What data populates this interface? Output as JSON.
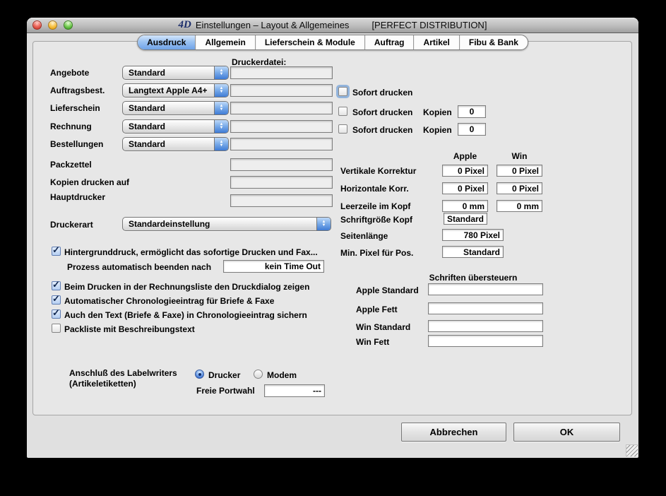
{
  "window": {
    "logo": "4D",
    "title_app": "Einstellungen – Layout & Allgemeines",
    "title_doc": "[PERFECT DISTRIBUTION]"
  },
  "tabs": [
    {
      "label": "Ausdruck",
      "selected": true
    },
    {
      "label": "Allgemein",
      "selected": false
    },
    {
      "label": "Lieferschein & Module",
      "selected": false
    },
    {
      "label": "Auftrag",
      "selected": false
    },
    {
      "label": "Artikel",
      "selected": false
    },
    {
      "label": "Fibu & Bank",
      "selected": false
    }
  ],
  "druckerdatei_header": "Druckerdatei:",
  "print_rows": [
    {
      "label": "Angebote",
      "popup": "Standard",
      "file": ""
    },
    {
      "label": "Auftragsbest.",
      "popup": "Langtext Apple A4+",
      "file": ""
    },
    {
      "label": "Lieferschein",
      "popup": "Standard",
      "file": ""
    },
    {
      "label": "Rechnung",
      "popup": "Standard",
      "file": ""
    },
    {
      "label": "Bestellungen",
      "popup": "Standard",
      "file": ""
    }
  ],
  "plain_rows": [
    {
      "label": "Packzettel",
      "value": ""
    },
    {
      "label": "Kopien drucken auf",
      "value": ""
    },
    {
      "label": "Hauptdrucker",
      "value": ""
    }
  ],
  "druckerart": {
    "label": "Druckerart",
    "value": "Standardeinstellung"
  },
  "checkboxes": {
    "hintergrunddruck": {
      "label": "Hintergrunddruck, ermöglicht das sofortige Drucken und Fax...",
      "checked": true
    },
    "prozess": {
      "label": "Prozess automatisch beenden nach",
      "value": "kein Time Out"
    },
    "druckdialog": {
      "label": "Beim Drucken in der Rechnungsliste den Druckdialog zeigen",
      "checked": true
    },
    "chrono": {
      "label": "Automatischer Chronologieeintrag für Briefe & Faxe",
      "checked": true
    },
    "chronotext": {
      "label": "Auch den Text (Briefe & Faxe) in Chronologieeintrag sichern",
      "checked": true
    },
    "packliste": {
      "label": "Packliste mit Beschreibungstext",
      "checked": false
    }
  },
  "labelwriter": {
    "label_line1": "Anschluß des Labelwriters",
    "label_line2": "(Artikeletiketten)",
    "radio_drucker": "Drucker",
    "radio_modem": "Modem",
    "selected_radio": "Drucker",
    "port_label": "Freie Portwahl",
    "port_value": "---"
  },
  "sofort": [
    {
      "label": "Sofort drucken",
      "checked": false
    },
    {
      "label": "Sofort drucken",
      "checked": false,
      "kopien_label": "Kopien",
      "kopien": "0"
    },
    {
      "label": "Sofort drucken",
      "checked": false,
      "kopien_label": "Kopien",
      "kopien": "0"
    }
  ],
  "correction": {
    "col_apple": "Apple",
    "col_win": "Win",
    "rows": [
      {
        "label": "Vertikale Korrektur",
        "apple": "0 Pixel",
        "win": "0 Pixel"
      },
      {
        "label": "Horizontale Korr.",
        "apple": "0 Pixel",
        "win": "0 Pixel"
      },
      {
        "label": "Leerzeile im Kopf",
        "apple": "0 mm",
        "win": "0 mm"
      },
      {
        "label": "Schriftgröße Kopf",
        "apple": "Standard"
      },
      {
        "label": "Seitenlänge",
        "apple": "780 Pixel"
      },
      {
        "label": "Min. Pixel für Pos.",
        "apple": "Standard"
      }
    ]
  },
  "fonts_override": {
    "header": "Schriften übersteuern",
    "rows": [
      {
        "label": "Apple Standard",
        "value": ""
      },
      {
        "label": "Apple Fett",
        "value": ""
      },
      {
        "label": "Win Standard",
        "value": ""
      },
      {
        "label": "Win Fett",
        "value": ""
      }
    ]
  },
  "buttons": {
    "cancel": "Abbrechen",
    "ok": "OK"
  },
  "icons": {
    "checkmark": "✓",
    "popup_up": "▲",
    "popup_down": "▼"
  },
  "colors": {
    "accent_blue": "#4a82d9",
    "tab_selected": "#6fa3e8",
    "titlebar_gray": "#bdbdbd"
  }
}
